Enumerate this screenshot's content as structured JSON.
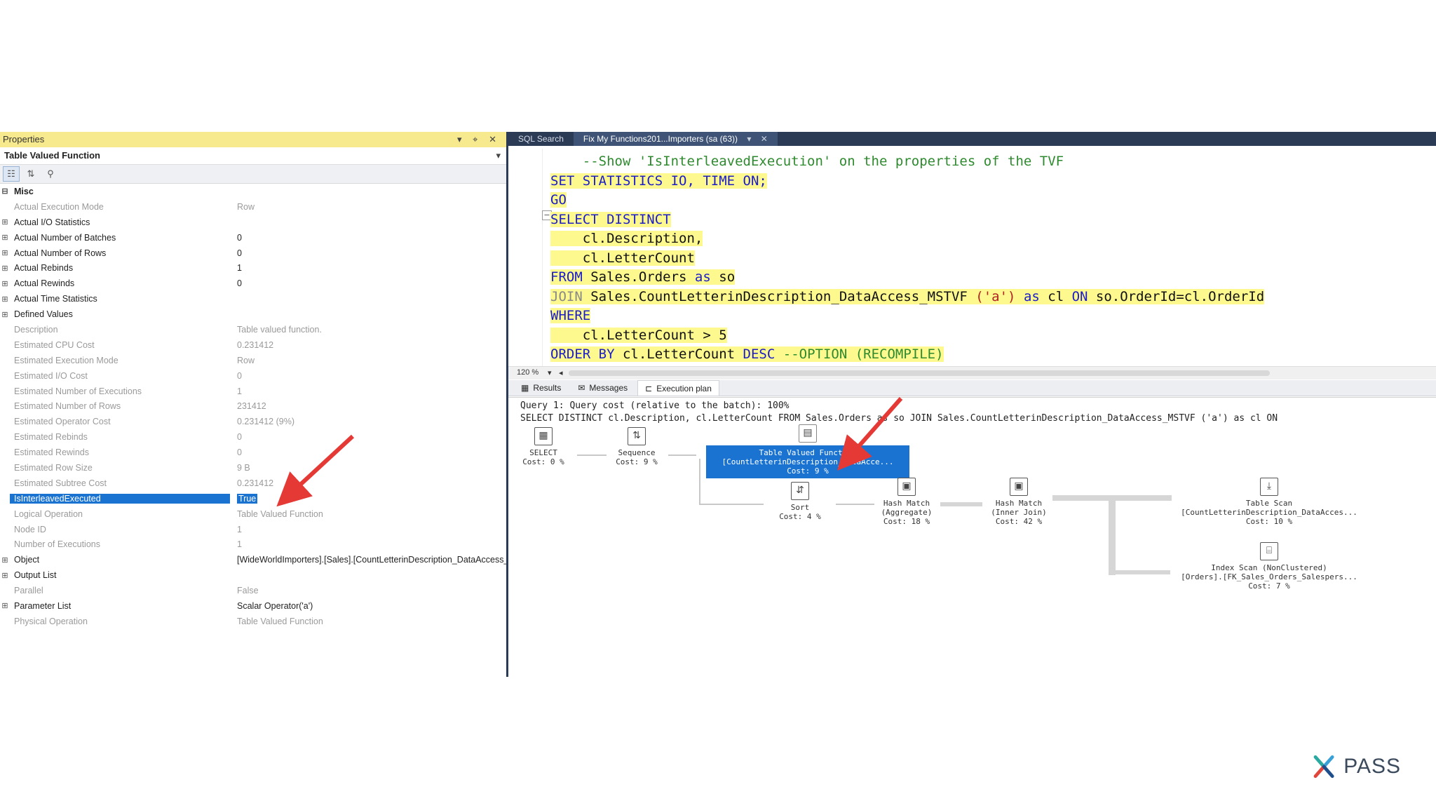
{
  "properties": {
    "title": "Properties",
    "window_controls": "▾ ⌖ ✕",
    "object_type": "Table Valued Function",
    "rows": [
      {
        "name": "Misc",
        "value": "",
        "kind": "cat",
        "expand": "⊟"
      },
      {
        "name": "Actual Execution Mode",
        "value": "Row",
        "kind": "gray",
        "expand": ""
      },
      {
        "name": "Actual I/O Statistics",
        "value": "",
        "kind": "dark",
        "expand": "⊞"
      },
      {
        "name": "Actual Number of Batches",
        "value": "0",
        "kind": "dark",
        "expand": "⊞"
      },
      {
        "name": "Actual Number of Rows",
        "value": "0",
        "kind": "dark",
        "expand": "⊞"
      },
      {
        "name": "Actual Rebinds",
        "value": "1",
        "kind": "dark",
        "expand": "⊞"
      },
      {
        "name": "Actual Rewinds",
        "value": "0",
        "kind": "dark",
        "expand": "⊞"
      },
      {
        "name": "Actual Time Statistics",
        "value": "",
        "kind": "dark",
        "expand": "⊞"
      },
      {
        "name": "Defined Values",
        "value": "",
        "kind": "dark",
        "expand": "⊞"
      },
      {
        "name": "Description",
        "value": "Table valued function.",
        "kind": "gray",
        "expand": ""
      },
      {
        "name": "Estimated CPU Cost",
        "value": "0.231412",
        "kind": "gray",
        "expand": ""
      },
      {
        "name": "Estimated Execution Mode",
        "value": "Row",
        "kind": "gray",
        "expand": ""
      },
      {
        "name": "Estimated I/O Cost",
        "value": "0",
        "kind": "gray",
        "expand": ""
      },
      {
        "name": "Estimated Number of Executions",
        "value": "1",
        "kind": "gray",
        "expand": ""
      },
      {
        "name": "Estimated Number of Rows",
        "value": "231412",
        "kind": "gray",
        "expand": ""
      },
      {
        "name": "Estimated Operator Cost",
        "value": "0.231412 (9%)",
        "kind": "gray",
        "expand": ""
      },
      {
        "name": "Estimated Rebinds",
        "value": "0",
        "kind": "gray",
        "expand": ""
      },
      {
        "name": "Estimated Rewinds",
        "value": "0",
        "kind": "gray",
        "expand": ""
      },
      {
        "name": "Estimated Row Size",
        "value": "9 B",
        "kind": "gray",
        "expand": ""
      },
      {
        "name": "Estimated Subtree Cost",
        "value": "0.231412",
        "kind": "gray",
        "expand": ""
      },
      {
        "name": "IsInterleavedExecuted",
        "value": "True",
        "kind": "sel",
        "expand": ""
      },
      {
        "name": "Logical Operation",
        "value": "Table Valued Function",
        "kind": "gray",
        "expand": ""
      },
      {
        "name": "Node ID",
        "value": "1",
        "kind": "gray",
        "expand": ""
      },
      {
        "name": "Number of Executions",
        "value": "1",
        "kind": "gray",
        "expand": ""
      },
      {
        "name": "Object",
        "value": "[WideWorldImporters].[Sales].[CountLetterinDescription_DataAccess_MSTVF]",
        "kind": "dark",
        "expand": "⊞"
      },
      {
        "name": "Output List",
        "value": "",
        "kind": "dark",
        "expand": "⊞"
      },
      {
        "name": "Parallel",
        "value": "False",
        "kind": "gray",
        "expand": ""
      },
      {
        "name": "Parameter List",
        "value": "Scalar Operator('a')",
        "kind": "dark",
        "expand": "⊞"
      },
      {
        "name": "Physical Operation",
        "value": "Table Valued Function",
        "kind": "gray",
        "expand": ""
      }
    ]
  },
  "editor": {
    "tabs": [
      {
        "label": "SQL Search",
        "active": false
      },
      {
        "label": "Fix My Functions201...Importers (sa (63))",
        "active": true
      }
    ],
    "tab_pin": "▾",
    "tab_close": "✕",
    "zoom": "120 %",
    "result_tabs": [
      "Results",
      "Messages",
      "Execution plan"
    ],
    "query_cost_line": "Query 1: Query cost (relative to the batch): 100%",
    "query_text_line": "SELECT DISTINCT cl.Description, cl.LetterCount FROM Sales.Orders as so JOIN Sales.CountLetterinDescription_DataAccess_MSTVF ('a') as cl ON"
  },
  "plan_nodes": [
    {
      "name": "SELECT",
      "cost": "Cost: 0 %",
      "icon": "▦"
    },
    {
      "name": "Sequence",
      "cost": "Cost: 9 %",
      "icon": "⇅"
    },
    {
      "name": "Table Valued Function",
      "sub": "[CountLetterinDescription_DataAcce...",
      "cost": "Cost: 9 %",
      "icon": "▤"
    },
    {
      "name": "Sort",
      "cost": "Cost: 4 %",
      "icon": "⇵"
    },
    {
      "name": "Hash Match",
      "sub": "(Aggregate)",
      "cost": "Cost: 18 %",
      "icon": "▣"
    },
    {
      "name": "Hash Match",
      "sub": "(Inner Join)",
      "cost": "Cost: 42 %",
      "icon": "▣"
    },
    {
      "name": "Table Scan",
      "sub": "[CountLetterinDescription_DataAcces...",
      "cost": "Cost: 10 %",
      "icon": "⤓"
    },
    {
      "name": "Index Scan (NonClustered)",
      "sub": "[Orders].[FK_Sales_Orders_Salespers...",
      "cost": "Cost: 7 %",
      "icon": "⌸"
    }
  ],
  "logo": {
    "text": "PASS"
  },
  "colors": {
    "selection": "#1a73d1",
    "highlight": "#fdf98f",
    "keyword": "#1c1cc8",
    "comment": "#2e8a2e",
    "annotation_arrow": "#e53935"
  }
}
